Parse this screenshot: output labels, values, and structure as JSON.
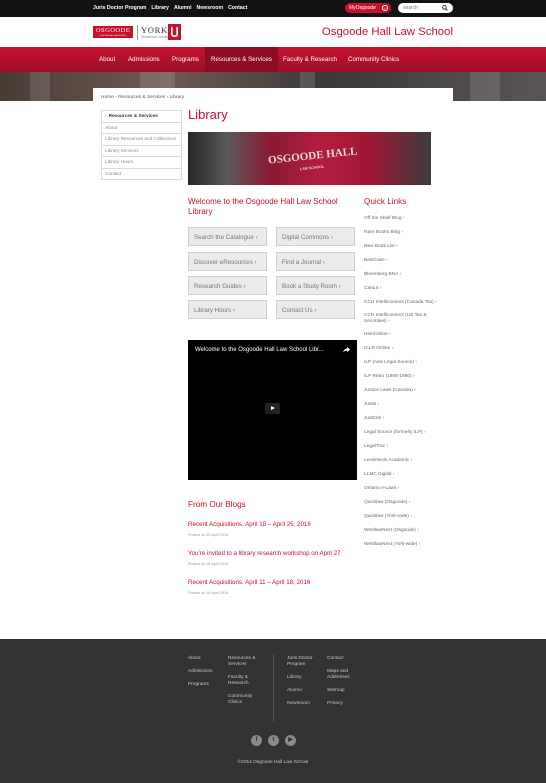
{
  "topbar": {
    "links": [
      "Juris Doctor Program",
      "Library",
      "Alumni",
      "Newsroom",
      "Contact"
    ],
    "myosgoode_label": "MyOsgoode",
    "search_placeholder": "search"
  },
  "header": {
    "logo_osgoode": "OSGOODE",
    "logo_osgoode_sub": "OSGOODE HALL LAW SCHOOL",
    "logo_york": "YORK",
    "logo_york_sub": "UNIVERSITÉ UNIVERSITY",
    "school_name": "Osgoode Hall Law School"
  },
  "nav": {
    "items": [
      "About",
      "Admissions",
      "Programs",
      "Resources & Services",
      "Faculty & Research",
      "Community Clinics"
    ],
    "active": "Resources & Services"
  },
  "breadcrumb": [
    "Home",
    "Resources & Services",
    "Library"
  ],
  "sidebar": {
    "header": "Resources & Services",
    "items": [
      "About",
      "Library Resources and Collections",
      "Library Services",
      "Library Hours",
      "Contact"
    ]
  },
  "main": {
    "title": "Library",
    "banner_text": "OSGOODE HALL",
    "banner_subtext": "LAW SCHOOL",
    "welcome_heading": "Welcome to the Osgoode Hall Law School Library",
    "buttons": [
      "Search the Catalogue ›",
      "Digital Commons ›",
      "Discover eResources ›",
      "Find a Journal ›",
      "Research Guides ›",
      "Book a Study Room ›",
      "Library Hours ›",
      "Contact Us ›"
    ],
    "video_title": "Welcome to the Osgoode Hall Law School Libr...",
    "blogs_heading": "From Our Blogs",
    "posts": [
      {
        "title": "Recent Acquisitions, April 18 – April 25, 2016",
        "date": "Posted on 25 April 2016"
      },
      {
        "title": "You’re invited to a library research workshop on April 27",
        "date": "Posted on 18 April 2016"
      },
      {
        "title": "Recent Acquisitions, April 11 – April 18, 2016",
        "date": "Posted on 18 April 2016"
      }
    ]
  },
  "quick_links": {
    "heading": "Quick Links",
    "items": [
      "Off the Shelf Blog ›",
      "Rare Books Blog ›",
      "New Book List ›",
      "BestCase ›",
      "Bloomberg BNA ›",
      "CanLII ›",
      "CCH Intelliconnect (Canada Tax) ›",
      "CCH Intelliconnect (US Tax & Securities) ›",
      "HeinOnline ›",
      "ICLR Online ›",
      "ILP (now Legal Source) ›",
      "ILP Retro (1908-1980) ›",
      "Justice Laws (Canada) ›",
      "Justis ›",
      "JustCite ›",
      "Legal Source (formerly ILP) ›",
      "LegalTrac ›",
      "LexisNexis Academic ›",
      "LLMC Digital ›",
      "Ontario e-Laws ›",
      "Quicklaw (Osgoode) ›",
      "Quicklaw (York-wide) ›",
      "WestlawNext (Osgoode) ›",
      "WestlawNext (York-wide) ›"
    ]
  },
  "footer": {
    "col1": [
      "About",
      "Admissions",
      "Programs"
    ],
    "col2": [
      "Resources & Services",
      "Faculty & Research",
      "Community Clinics"
    ],
    "col3": [
      "Juris Doctor Program",
      "Library",
      "Alumni",
      "Newsroom"
    ],
    "col4": [
      "Contact",
      "Maps and Addresses",
      "Sitemap",
      "Privacy"
    ],
    "social": [
      "f",
      "t",
      "▶"
    ],
    "copyright": "©2014 Osgoode Hall Law School"
  },
  "colors": {
    "brand_red": "#c8102e",
    "footer_bg": "#333333",
    "topbar_bg": "#121212"
  }
}
